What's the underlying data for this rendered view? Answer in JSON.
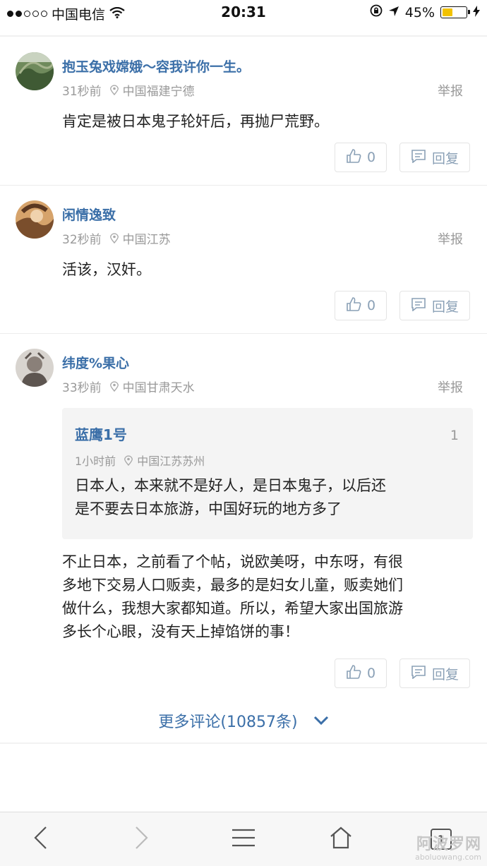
{
  "status_bar": {
    "carrier": "中国电信",
    "time": "20:31",
    "battery": "45%",
    "battery_level": 0.45
  },
  "comments": [
    {
      "username": "抱玉兔戏嫦娥～容我许你一生。",
      "time": "31秒前",
      "location": "中国福建宁德",
      "report": "举报",
      "text": "肯定是被日本鬼子轮奸后，再抛尸荒野。",
      "likes": "0",
      "reply": "回复"
    },
    {
      "username": "闲情逸致",
      "time": "32秒前",
      "location": "中国江苏",
      "report": "举报",
      "text": "活该，汉奸。",
      "likes": "0",
      "reply": "回复"
    },
    {
      "username": "纬度%果心",
      "time": "33秒前",
      "location": "中国甘肃天水",
      "report": "举报",
      "quote": {
        "username": "蓝鹰1号",
        "count": "1",
        "time": "1小时前",
        "location": "中国江苏苏州",
        "lines": [
          "日本人，本来就不是好人，是日本鬼子，以后还",
          "是不要去日本旅游，中国好玩的地方多了"
        ]
      },
      "lines": [
        "不止日本，之前看了个帖，说欧美呀，中东呀，有很",
        "多地下交易人口贩卖，最多的是妇女儿童，贩卖她们",
        "做什么，我想大家都知道。所以，希望大家出国旅游",
        "多长个心眼，没有天上掉馅饼的事！"
      ],
      "likes": "0",
      "reply": "回复"
    }
  ],
  "more_comments": "更多评论(10857条)",
  "bottom_nav": {
    "tab_count": "1"
  },
  "watermark": {
    "logo": "阿波罗网",
    "url": "aboluowang.com"
  }
}
